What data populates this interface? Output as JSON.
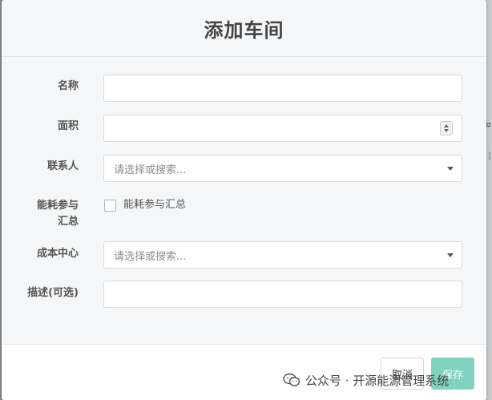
{
  "modal": {
    "title": "添加车间"
  },
  "form": {
    "name_label": "名称",
    "area_label": "面积",
    "contact_label": "联系人",
    "contact_placeholder": "请选择或搜索...",
    "energy_label_line1": "能耗参与",
    "energy_label_line2": "汇总",
    "energy_checkbox_label": "能耗参与汇总",
    "energy_checked": false,
    "cost_center_label": "成本中心",
    "cost_center_placeholder": "请选择或搜索...",
    "description_label": "描述(可选)"
  },
  "footer": {
    "cancel_label": "取消",
    "save_label": "保存"
  },
  "watermark": {
    "text": "公众号 · 开源能源管理系统"
  },
  "colors": {
    "save_button": "#7fd3c0",
    "title": "#444444",
    "backdrop": "#8a8d90"
  }
}
